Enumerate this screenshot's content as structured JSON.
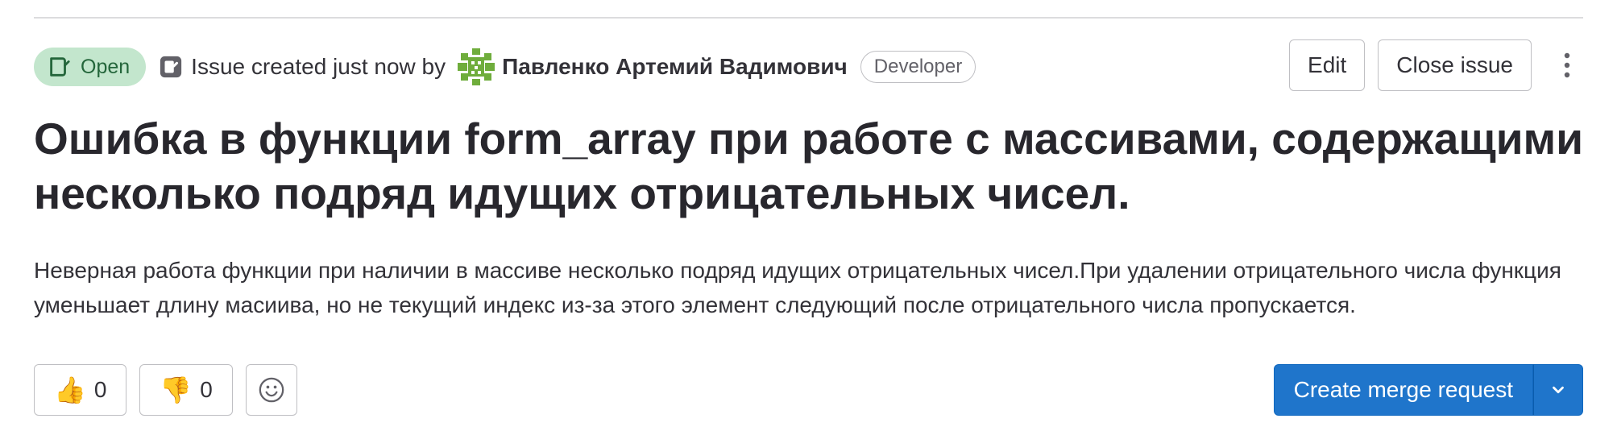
{
  "issue": {
    "status": "Open",
    "created_text": "Issue created just now by",
    "author": "Павленко Артемий Вадимович",
    "author_role": "Developer",
    "title": "Ошибка в функции form_array при работе с массивами, содержащими несколько подряд идущих отрицательных чисел.",
    "description": "Неверная работа функции при наличии в массиве несколько подряд идущих отрицательных чисел.При удалении отрицательного числа функция уменьшает длину масиива, но не текущий индекс из-за этого элемент следующий после отрицательного числа пропускается."
  },
  "actions": {
    "edit_label": "Edit",
    "close_label": "Close issue",
    "more_icon": "kebab-vertical-icon"
  },
  "reactions": {
    "thumbs_up": {
      "emoji": "👍",
      "count": "0"
    },
    "thumbs_down": {
      "emoji": "👎",
      "count": "0"
    },
    "add_icon": "smiley-icon"
  },
  "merge_request": {
    "label": "Create merge request",
    "toggle_icon": "chevron-down-icon"
  },
  "colors": {
    "open_bg": "#c3e6cd",
    "open_text": "#24663b",
    "primary_blue": "#1f75cb",
    "avatar_green": "#6fad3c"
  }
}
